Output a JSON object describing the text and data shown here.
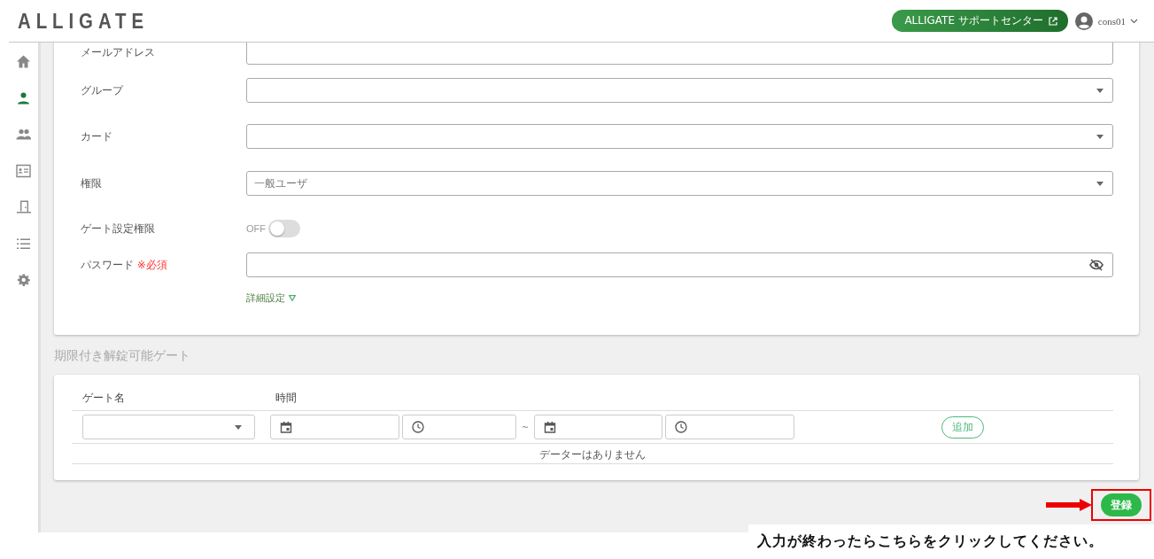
{
  "header": {
    "logo": "ALLIGATE",
    "support_button": "ALLIGATE サポートセンター",
    "user": "cons01"
  },
  "sidebar": {
    "items": [
      {
        "kind": "home",
        "selected": false
      },
      {
        "kind": "person",
        "selected": true
      },
      {
        "kind": "people",
        "selected": false
      },
      {
        "kind": "card",
        "selected": false
      },
      {
        "kind": "door",
        "selected": false
      },
      {
        "kind": "list",
        "selected": false
      },
      {
        "kind": "gear",
        "selected": false
      }
    ]
  },
  "form": {
    "fields": [
      {
        "label": "メールアドレス",
        "kind": "text"
      },
      {
        "label": "グループ",
        "kind": "select"
      },
      {
        "label": "カード",
        "kind": "select"
      },
      {
        "label": "権限",
        "kind": "select",
        "value": "一般ユーザ"
      },
      {
        "label": "ゲート設定権限",
        "kind": "toggle",
        "on": false,
        "state_label": "OFF"
      },
      {
        "label": "パスワード",
        "required_mark": "※必須",
        "kind": "password"
      }
    ],
    "details_link": "詳細設定"
  },
  "gate_section": {
    "title": "期限付き解錠可能ゲート",
    "columns": [
      "ゲート名",
      "時間"
    ],
    "range_separator": "~",
    "add_button": "追加",
    "empty_message": "データーはありません"
  },
  "submit_button": "登録",
  "annotation": "入力が終わったらこちらをクリックしてください。"
}
